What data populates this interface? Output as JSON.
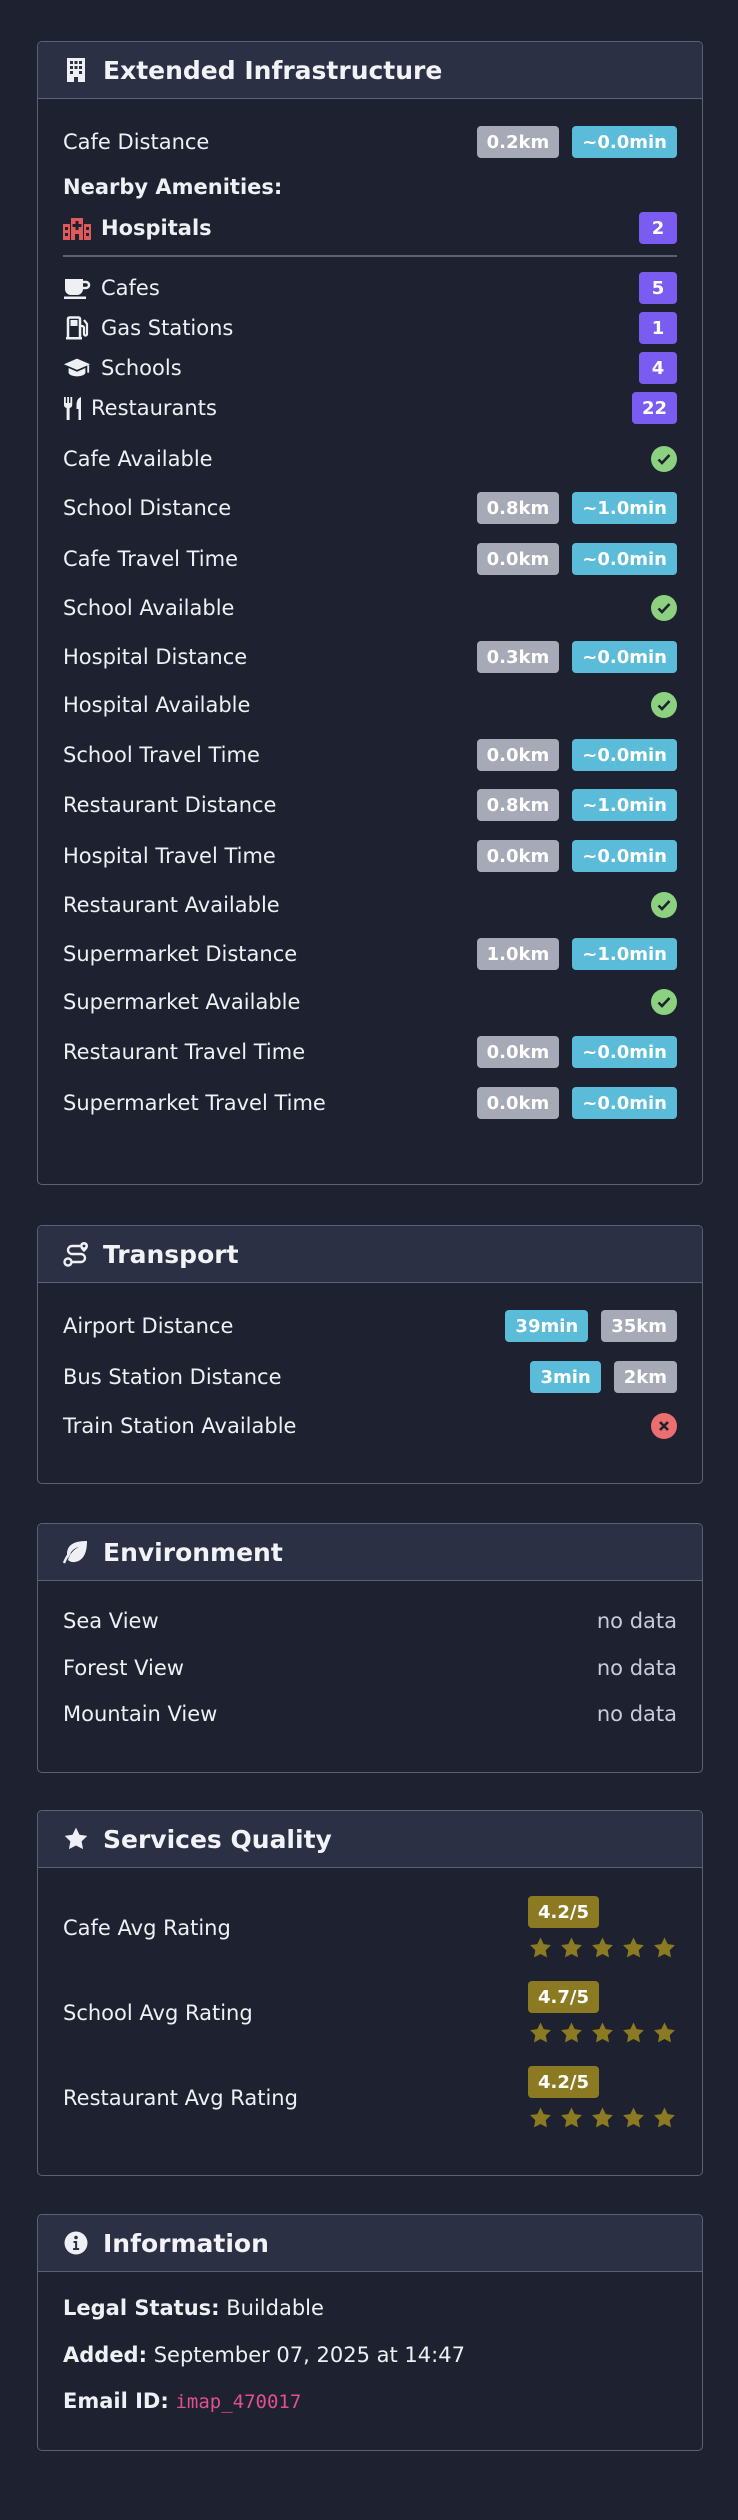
{
  "colors": {
    "background": "#1e2230",
    "header": "#2b3044",
    "badge_gray": "#a6a9b6",
    "badge_cyan": "#5bbcd9",
    "badge_purple": "#7b5cf0",
    "rating_gold": "#8c7a22",
    "check_green": "#8bd17f",
    "cross_red": "#ec6f6f",
    "hospital_icon": "#e05a5a"
  },
  "infra": {
    "title": "Extended Infrastructure",
    "icon": "building-icon",
    "cafe_distance": {
      "label": "Cafe Distance",
      "km": "0.2km",
      "min": "~0.0min"
    },
    "nearby_label": "Nearby Amenities:",
    "amenities": [
      {
        "label": "Hospitals",
        "count": "2",
        "icon": "hospital-icon"
      },
      {
        "label": "Cafes",
        "count": "5",
        "icon": "coffee-cup-icon"
      },
      {
        "label": "Gas Stations",
        "count": "1",
        "icon": "gas-pump-icon"
      },
      {
        "label": "Schools",
        "count": "4",
        "icon": "graduation-cap-icon"
      },
      {
        "label": "Restaurants",
        "count": "22",
        "icon": "utensils-icon"
      }
    ],
    "rows": [
      {
        "label": "Cafe Available",
        "type": "check"
      },
      {
        "label": "School Distance",
        "km": "0.8km",
        "min": "~1.0min"
      },
      {
        "label": "Cafe Travel Time",
        "km": "0.0km",
        "min": "~0.0min"
      },
      {
        "label": "School Available",
        "type": "check"
      },
      {
        "label": "Hospital Distance",
        "km": "0.3km",
        "min": "~0.0min"
      },
      {
        "label": "Hospital Available",
        "type": "check"
      },
      {
        "label": "School Travel Time",
        "km": "0.0km",
        "min": "~0.0min"
      },
      {
        "label": "Restaurant Distance",
        "km": "0.8km",
        "min": "~1.0min"
      },
      {
        "label": "Hospital Travel Time",
        "km": "0.0km",
        "min": "~0.0min"
      },
      {
        "label": "Restaurant Available",
        "type": "check"
      },
      {
        "label": "Supermarket Distance",
        "km": "1.0km",
        "min": "~1.0min"
      },
      {
        "label": "Supermarket Available",
        "type": "check"
      },
      {
        "label": "Restaurant Travel Time",
        "km": "0.0km",
        "min": "~0.0min"
      },
      {
        "label": "Supermarket Travel Time",
        "km": "0.0km",
        "min": "~0.0min"
      }
    ]
  },
  "transport": {
    "title": "Transport",
    "icon": "route-icon",
    "airport": {
      "label": "Airport Distance",
      "min": "39min",
      "km": "35km"
    },
    "bus": {
      "label": "Bus Station Distance",
      "min": "3min",
      "km": "2km"
    },
    "train": {
      "label": "Train Station Available",
      "available": false
    }
  },
  "environment": {
    "title": "Environment",
    "icon": "leaf-icon",
    "rows": [
      {
        "label": "Sea View",
        "value": "no data"
      },
      {
        "label": "Forest View",
        "value": "no data"
      },
      {
        "label": "Mountain View",
        "value": "no data"
      }
    ]
  },
  "services": {
    "title": "Services Quality",
    "icon": "star-icon",
    "ratings": [
      {
        "label": "Cafe Avg Rating",
        "value": "4.2/5",
        "stars": 5
      },
      {
        "label": "School Avg Rating",
        "value": "4.7/5",
        "stars": 5
      },
      {
        "label": "Restaurant Avg Rating",
        "value": "4.2/5",
        "stars": 5
      }
    ]
  },
  "information": {
    "title": "Information",
    "icon": "info-circle-icon",
    "legal_label": "Legal Status:",
    "legal_value": "Buildable",
    "added_label": "Added:",
    "added_value": "September 07, 2025 at 14:47",
    "email_label": "Email ID:",
    "email_value": "imap_470017"
  }
}
